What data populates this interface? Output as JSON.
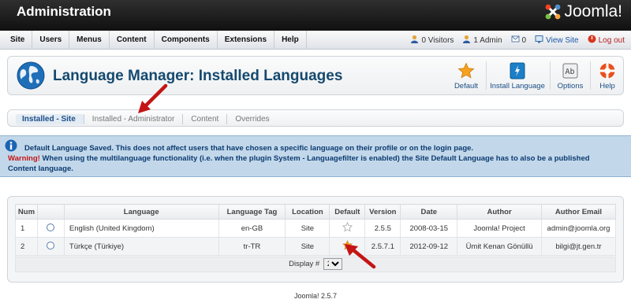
{
  "header": {
    "title": "Administration",
    "brand": "Joomla!"
  },
  "menubar": {
    "items": [
      "Site",
      "Users",
      "Menus",
      "Content",
      "Components",
      "Extensions",
      "Help"
    ],
    "visitors": "0 Visitors",
    "admins": "1 Admin",
    "messages": "0",
    "view_site": "View Site",
    "logout": "Log out"
  },
  "toolbar": {
    "page_title": "Language Manager: Installed Languages",
    "buttons": {
      "default": "Default",
      "install": "Install Language",
      "options": "Options",
      "help": "Help"
    }
  },
  "tabs": [
    "Installed - Site",
    "Installed - Administrator",
    "Content",
    "Overrides"
  ],
  "message": {
    "info": "Default Language Saved. This does not affect users that have chosen a specific language on their profile or on the login page.",
    "warning_label": "Warning!",
    "warning": " When using the multilanguage functionality (i.e. when the plugin System - Languagefilter is enabled) the Site Default Language has to also be a published Content language."
  },
  "table": {
    "headers": [
      "Num",
      "",
      "Language",
      "Language Tag",
      "Location",
      "Default",
      "Version",
      "Date",
      "Author",
      "Author Email"
    ],
    "rows": [
      {
        "num": "1",
        "language": "English (United Kingdom)",
        "tag": "en-GB",
        "location": "Site",
        "default": false,
        "version": "2.5.5",
        "date": "2008-03-15",
        "author": "Joomla! Project",
        "email": "admin@joomla.org"
      },
      {
        "num": "2",
        "language": "Türkçe (Türkiye)",
        "tag": "tr-TR",
        "location": "Site",
        "default": true,
        "version": "2.5.7.1",
        "date": "2012-09-12",
        "author": "Ümit Kenan Gönüllü",
        "email": "bilgi@jt.gen.tr"
      }
    ],
    "display_label": "Display #",
    "display_value": "20"
  },
  "footer": "Joomla! 2.5.7",
  "colors": {
    "accent": "#15496f",
    "star": "#f39c12",
    "arrow": "#c41414",
    "message_bg": "#c2d8ea"
  }
}
